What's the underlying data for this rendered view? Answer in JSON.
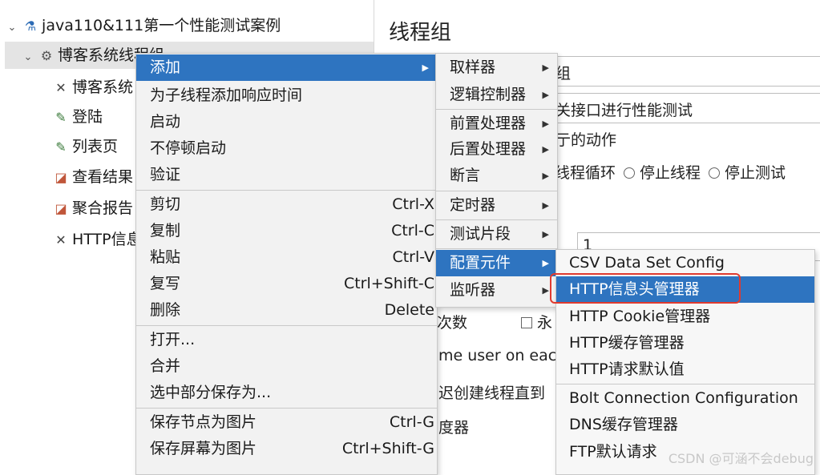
{
  "tree": {
    "items": [
      {
        "label": "java110&111第一个性能测试案例",
        "icon": "flask-icon",
        "expanded": true
      },
      {
        "label": "博客系统线程组",
        "icon": "gear-icon",
        "expanded": true,
        "selected": true
      },
      {
        "label": "博客系统",
        "icon": "wrench-icon"
      },
      {
        "label": "登陆",
        "icon": "pencil-icon"
      },
      {
        "label": "列表页",
        "icon": "pencil-icon"
      },
      {
        "label": "查看结果",
        "icon": "graph-icon"
      },
      {
        "label": "聚合报告",
        "icon": "graph-icon"
      },
      {
        "label": "HTTP信息",
        "icon": "wrench-icon"
      }
    ]
  },
  "panel": {
    "title": "线程组",
    "name_tail": "组",
    "comment_tail": "关接口进行性能测试",
    "action_label": "亍的动作",
    "action_options": [
      "线程循环",
      "停止线程",
      "停止测试"
    ],
    "thread_value": "1",
    "loop_label": "次数",
    "forever_label": "永",
    "same_user": "me user on eacl",
    "delay_label": "迟创建线程直到",
    "scheduler_label": "度器"
  },
  "main_menu": {
    "items": [
      {
        "label": "添加",
        "submenu": true,
        "highlighted": true
      },
      {
        "label": "为子线程添加响应时间"
      },
      {
        "label": "启动"
      },
      {
        "label": "不停顿启动"
      },
      {
        "label": "验证"
      },
      {
        "label": "剪切",
        "shortcut": "Ctrl-X"
      },
      {
        "label": "复制",
        "shortcut": "Ctrl-C"
      },
      {
        "label": "粘贴",
        "shortcut": "Ctrl-V"
      },
      {
        "label": "复写",
        "shortcut": "Ctrl+Shift-C"
      },
      {
        "label": "删除",
        "shortcut": "Delete"
      },
      {
        "label": "打开..."
      },
      {
        "label": "合并"
      },
      {
        "label": "选中部分保存为..."
      },
      {
        "label": "保存节点为图片",
        "shortcut": "Ctrl-G"
      },
      {
        "label": "保存屏幕为图片",
        "shortcut": "Ctrl+Shift-G"
      }
    ]
  },
  "add_menu": {
    "items": [
      {
        "label": "取样器"
      },
      {
        "label": "逻辑控制器"
      },
      {
        "label": "前置处理器"
      },
      {
        "label": "后置处理器"
      },
      {
        "label": "断言"
      },
      {
        "label": "定时器"
      },
      {
        "label": "测试片段"
      },
      {
        "label": "配置元件",
        "highlighted": true
      },
      {
        "label": "监听器"
      }
    ]
  },
  "config_menu": {
    "items": [
      {
        "label": "CSV Data Set Config"
      },
      {
        "label": "HTTP信息头管理器",
        "highlighted": true
      },
      {
        "label": "HTTP Cookie管理器"
      },
      {
        "label": "HTTP缓存管理器"
      },
      {
        "label": "HTTP请求默认值"
      },
      {
        "label": "Bolt Connection Configuration"
      },
      {
        "label": "DNS缓存管理器"
      },
      {
        "label": "FTP默认请求"
      }
    ]
  },
  "watermark": "CSDN @可涵不会debug",
  "colors": {
    "highlight": "#2e74c0",
    "annotation": "#e03a2f",
    "menu_bg": "#f2f2f2"
  }
}
